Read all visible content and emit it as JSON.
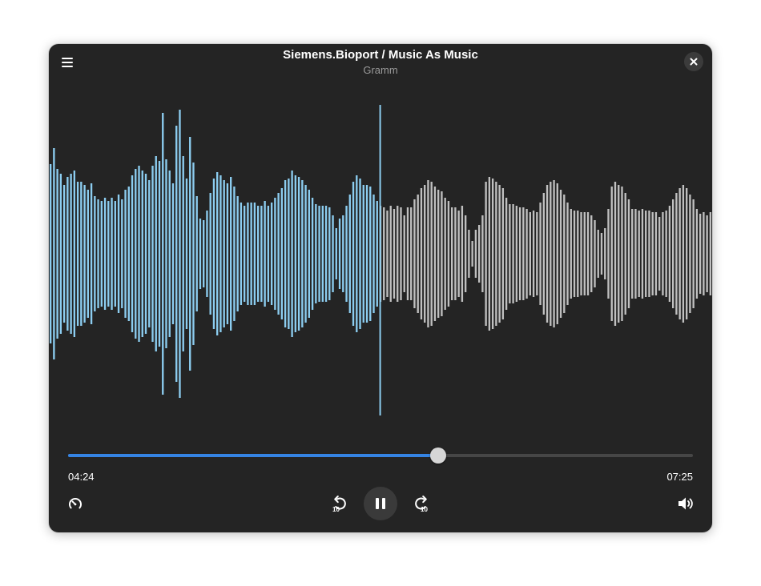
{
  "window": {
    "title": "Siemens.Bioport / Music As Music",
    "subtitle": "Gramm"
  },
  "playback": {
    "elapsed": "04:24",
    "total": "07:25",
    "progress": 0.592,
    "state": "playing"
  },
  "controls": {
    "menu_icon": "hamburger-menu-icon",
    "close_icon": "close-icon",
    "speed_icon": "playback-speed-icon",
    "skip_back_icon": "skip-back-10-icon",
    "skip_back_label": "10",
    "pause_icon": "pause-icon",
    "skip_forward_icon": "skip-forward-10-icon",
    "skip_forward_label": "10",
    "volume_icon": "volume-icon"
  },
  "waveform": {
    "played_color": "#8ccdf0",
    "unplayed_color": "#c0c0c0",
    "playhead_color": "#8ccdf0",
    "peaks": [
      0.56,
      0.66,
      0.53,
      0.5,
      0.43,
      0.48,
      0.5,
      0.52,
      0.45,
      0.45,
      0.43,
      0.4,
      0.44,
      0.36,
      0.34,
      0.33,
      0.35,
      0.33,
      0.35,
      0.33,
      0.37,
      0.34,
      0.4,
      0.42,
      0.49,
      0.53,
      0.55,
      0.52,
      0.5,
      0.46,
      0.55,
      0.61,
      0.58,
      0.88,
      0.59,
      0.52,
      0.44,
      0.8,
      0.9,
      0.61,
      0.47,
      0.73,
      0.57,
      0.36,
      0.22,
      0.21,
      0.27,
      0.38,
      0.47,
      0.51,
      0.49,
      0.46,
      0.44,
      0.48,
      0.42,
      0.36,
      0.32,
      0.3,
      0.32,
      0.32,
      0.32,
      0.3,
      0.3,
      0.33,
      0.3,
      0.32,
      0.35,
      0.38,
      0.41,
      0.46,
      0.47,
      0.52,
      0.49,
      0.48,
      0.46,
      0.43,
      0.4,
      0.35,
      0.31,
      0.3,
      0.3,
      0.3,
      0.29,
      0.24,
      0.16,
      0.22,
      0.24,
      0.3,
      0.37,
      0.45,
      0.49,
      0.47,
      0.43,
      0.43,
      0.42,
      0.37,
      0.33,
      0.3,
      0.29,
      0.27,
      0.3,
      0.28,
      0.3,
      0.29,
      0.24,
      0.29,
      0.29,
      0.34,
      0.37,
      0.41,
      0.43,
      0.46,
      0.45,
      0.42,
      0.4,
      0.39,
      0.35,
      0.33,
      0.29,
      0.29,
      0.27,
      0.3,
      0.24,
      0.15,
      0.08,
      0.15,
      0.18,
      0.24,
      0.45,
      0.48,
      0.47,
      0.45,
      0.43,
      0.41,
      0.35,
      0.31,
      0.31,
      0.3,
      0.29,
      0.29,
      0.28,
      0.26,
      0.27,
      0.26,
      0.32,
      0.38,
      0.43,
      0.45,
      0.46,
      0.44,
      0.4,
      0.37,
      0.32,
      0.28,
      0.27,
      0.27,
      0.26,
      0.26,
      0.26,
      0.24,
      0.21,
      0.15,
      0.13,
      0.16,
      0.28,
      0.42,
      0.45,
      0.43,
      0.42,
      0.38,
      0.34,
      0.28,
      0.28,
      0.27,
      0.28,
      0.27,
      0.27,
      0.26,
      0.26,
      0.23,
      0.26,
      0.27,
      0.3,
      0.34,
      0.38,
      0.41,
      0.43,
      0.41,
      0.37,
      0.34,
      0.28,
      0.25,
      0.26,
      0.24,
      0.26
    ]
  }
}
